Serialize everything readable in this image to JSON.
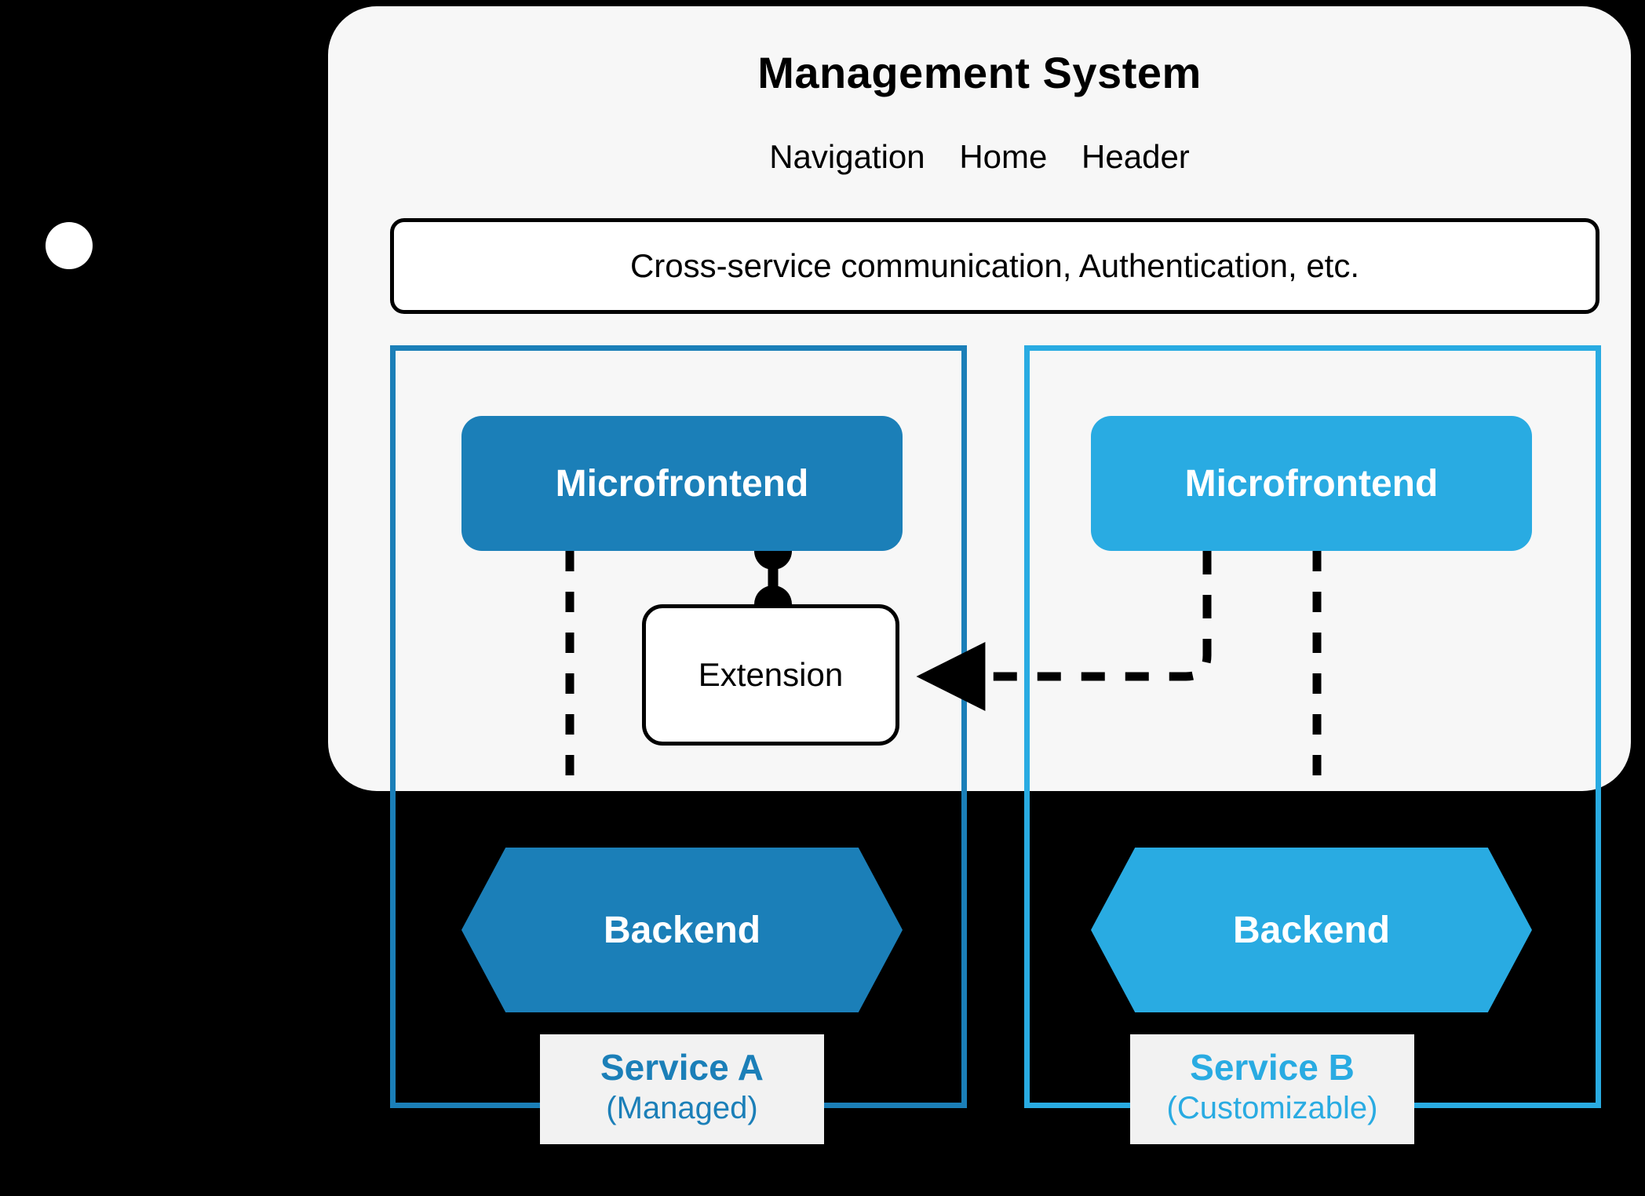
{
  "diagram": {
    "background_color": "#000000",
    "panel": {
      "title": "Management System",
      "panel_bg": "#f7f7f7",
      "subtitle_items": [
        "Navigation",
        "Home",
        "Header"
      ],
      "cross_service_band": "Cross-service communication, Authentication, etc."
    },
    "actor": {
      "name": "user-actor",
      "color": "#ffffff"
    },
    "services": [
      {
        "id": "service-a",
        "name": "Service A",
        "kind": "(Managed)",
        "color": "#1b7fb8",
        "microfrontend_label": "Microfrontend",
        "backend_label": "Backend"
      },
      {
        "id": "service-b",
        "name": "Service B",
        "kind": "(Customizable)",
        "color": "#29abe2",
        "microfrontend_label": "Microfrontend",
        "backend_label": "Backend"
      }
    ],
    "extension": {
      "label": "Extension",
      "border_color": "#000000",
      "fill": "#ffffff"
    },
    "connectors": {
      "socket_color": "#000000",
      "dashed_color": "#000000"
    }
  }
}
